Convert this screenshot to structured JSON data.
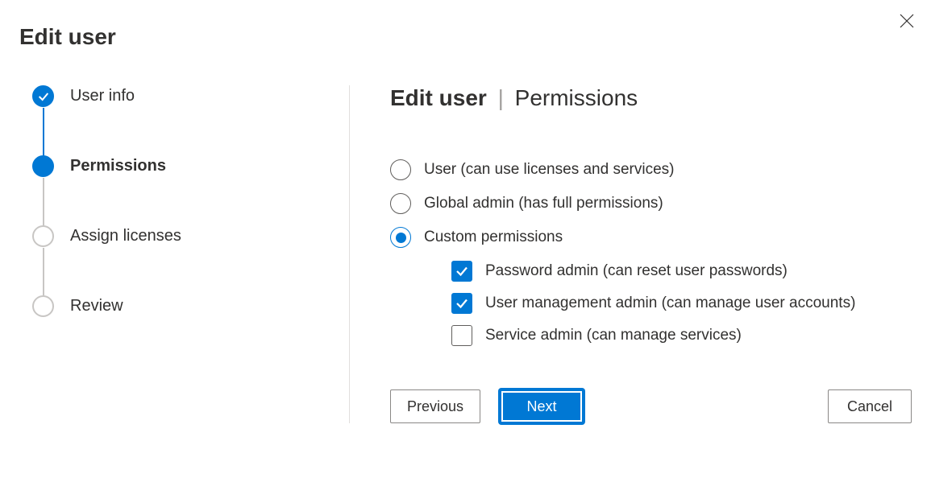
{
  "dialog": {
    "title": "Edit user"
  },
  "stepper": {
    "steps": [
      {
        "label": "User info",
        "state": "done"
      },
      {
        "label": "Permissions",
        "state": "current"
      },
      {
        "label": "Assign licenses",
        "state": "pending"
      },
      {
        "label": "Review",
        "state": "pending"
      }
    ]
  },
  "panel": {
    "title_strong": "Edit user",
    "title_sub": "Permissions"
  },
  "permissions": {
    "radios": [
      {
        "key": "user",
        "label": "User (can use licenses and services)",
        "selected": false
      },
      {
        "key": "global",
        "label": "Global admin (has full permissions)",
        "selected": false
      },
      {
        "key": "custom",
        "label": "Custom permissions",
        "selected": true
      }
    ],
    "custom_checks": [
      {
        "key": "password",
        "label": "Password admin (can reset user passwords)",
        "checked": true
      },
      {
        "key": "usermgmt",
        "label": "User management admin (can manage user accounts)",
        "checked": true
      },
      {
        "key": "service",
        "label": "Service admin (can manage services)",
        "checked": false
      }
    ]
  },
  "footer": {
    "previous": "Previous",
    "next": "Next",
    "cancel": "Cancel"
  }
}
